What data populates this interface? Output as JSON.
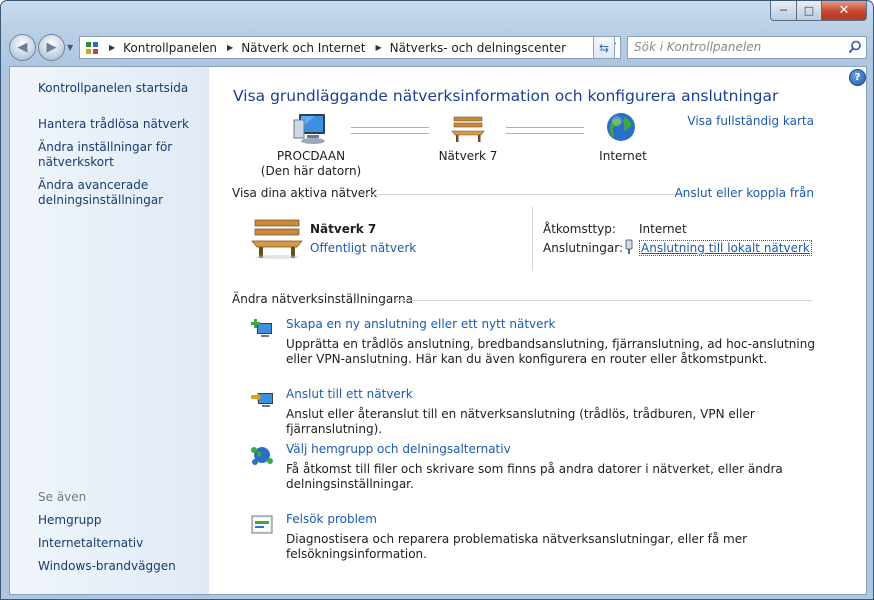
{
  "window": {
    "min_glyph": "─",
    "max_glyph": "□",
    "close_glyph": "✕"
  },
  "navbar": {
    "back_glyph": "◀",
    "forward_glyph": "▶",
    "dropdown_glyph": "▼",
    "breadcrumbs": [
      "Kontrollpanelen",
      "Nätverk och Internet",
      "Nätverks- och delningscenter"
    ],
    "crumb_sep": "▶",
    "address_dropdown_glyph": "▼",
    "refresh_glyph": "⇆",
    "search_placeholder": "Sök i Kontrollpanelen"
  },
  "sidebar": {
    "home": "Kontrollpanelen startsida",
    "links": [
      "Hantera trådlösa nätverk",
      "Ändra inställningar för nätverkskort",
      "Ändra avancerade delningsinställningar"
    ],
    "see_also_label": "Se även",
    "see_also": [
      "Hemgrupp",
      "Internetalternativ",
      "Windows-brandväggen"
    ]
  },
  "main": {
    "help_glyph": "?",
    "title": "Visa grundläggande nätverksinformation och konfigurera anslutningar",
    "full_map_link": "Visa fullständig karta",
    "nodes": {
      "computer": {
        "name": "PROCDAAN",
        "sub": "(Den här datorn)"
      },
      "network": {
        "name": "Nätverk  7"
      },
      "internet": {
        "name": "Internet"
      }
    },
    "active_header": "Visa dina aktiva nätverk",
    "connect_link": "Anslut eller koppla från",
    "active_network": {
      "name": "Nätverk  7",
      "type": "Offentligt nätverk",
      "access_label": "Åtkomsttyp:",
      "access_value": "Internet",
      "connections_label": "Anslutningar:",
      "connections_value": "Anslutning till lokalt nätverk"
    },
    "change_header": "Ändra nätverksinställningarna",
    "tasks": [
      {
        "title": "Skapa en ny anslutning eller ett nytt nätverk",
        "desc": "Upprätta en trådlös anslutning, bredbandsanslutning, fjärranslutning, ad hoc-anslutning eller VPN-anslutning. Här kan du även konfigurera en router eller åtkomstpunkt."
      },
      {
        "title": "Anslut till ett nätverk",
        "desc": "Anslut eller återanslut till en nätverksanslutning (trådlös, trådburen, VPN eller fjärranslutning)."
      },
      {
        "title": "Välj hemgrupp och delningsalternativ",
        "desc": "Få åtkomst till filer och skrivare som finns på andra datorer i nätverket, eller ändra delningsinställningar."
      },
      {
        "title": "Felsök problem",
        "desc": "Diagnostisera och reparera problematiska nätverksanslutningar, eller få mer felsökningsinformation."
      }
    ]
  },
  "colors": {
    "link": "#1c5ab0",
    "title": "#1c3f94",
    "sidebar_link": "#183d6e"
  }
}
